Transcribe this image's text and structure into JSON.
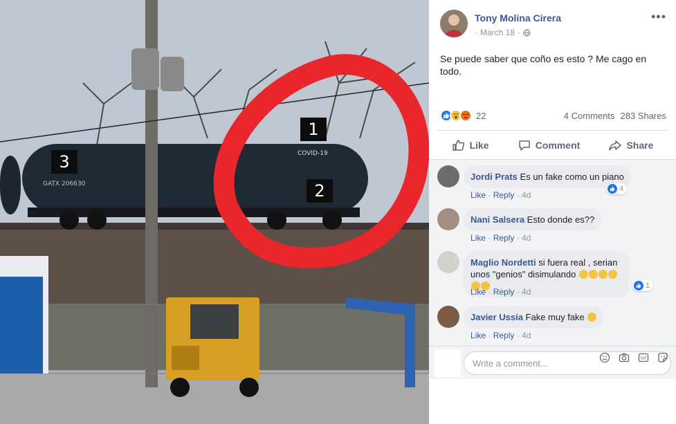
{
  "photo": {
    "markers": [
      "1",
      "2",
      "3"
    ],
    "car_text_1": "COVID-19",
    "car_text_2": "GATX 206630"
  },
  "post": {
    "author": "Tony Molina Cirera",
    "date": "March 18",
    "separator": "·",
    "text": "Se puede saber que coño es esto ? Me cago en todo.",
    "reaction_count": "22",
    "comments_count": "4 Comments",
    "shares_count": "283 Shares",
    "more_icon": "ellipsis-icon"
  },
  "actions": {
    "like": "Like",
    "comment": "Comment",
    "share": "Share"
  },
  "comments": [
    {
      "name": "Jordi Prats",
      "text": "Es un fake como un piano",
      "like": "Like",
      "reply": "Reply",
      "time": "4d",
      "likes": "4"
    },
    {
      "name": "Nani Salsera",
      "text": "Esto donde es??",
      "like": "Like",
      "reply": "Reply",
      "time": "4d",
      "likes": ""
    },
    {
      "name": "Maglio Nordetti",
      "text": "si fuera real , serian unos \"genios\" disimulando",
      "like": "Like",
      "reply": "Reply",
      "time": "4d",
      "likes": "1"
    },
    {
      "name": "Javier Ussía",
      "text": "Fake muy fake",
      "like": "Like",
      "reply": "Reply",
      "time": "4d",
      "likes": ""
    }
  ],
  "composer": {
    "placeholder": "Write a comment..."
  },
  "colors": {
    "link_blue": "#385898",
    "like_blue": "#1877f2",
    "annotation_red": "#e8262b"
  }
}
